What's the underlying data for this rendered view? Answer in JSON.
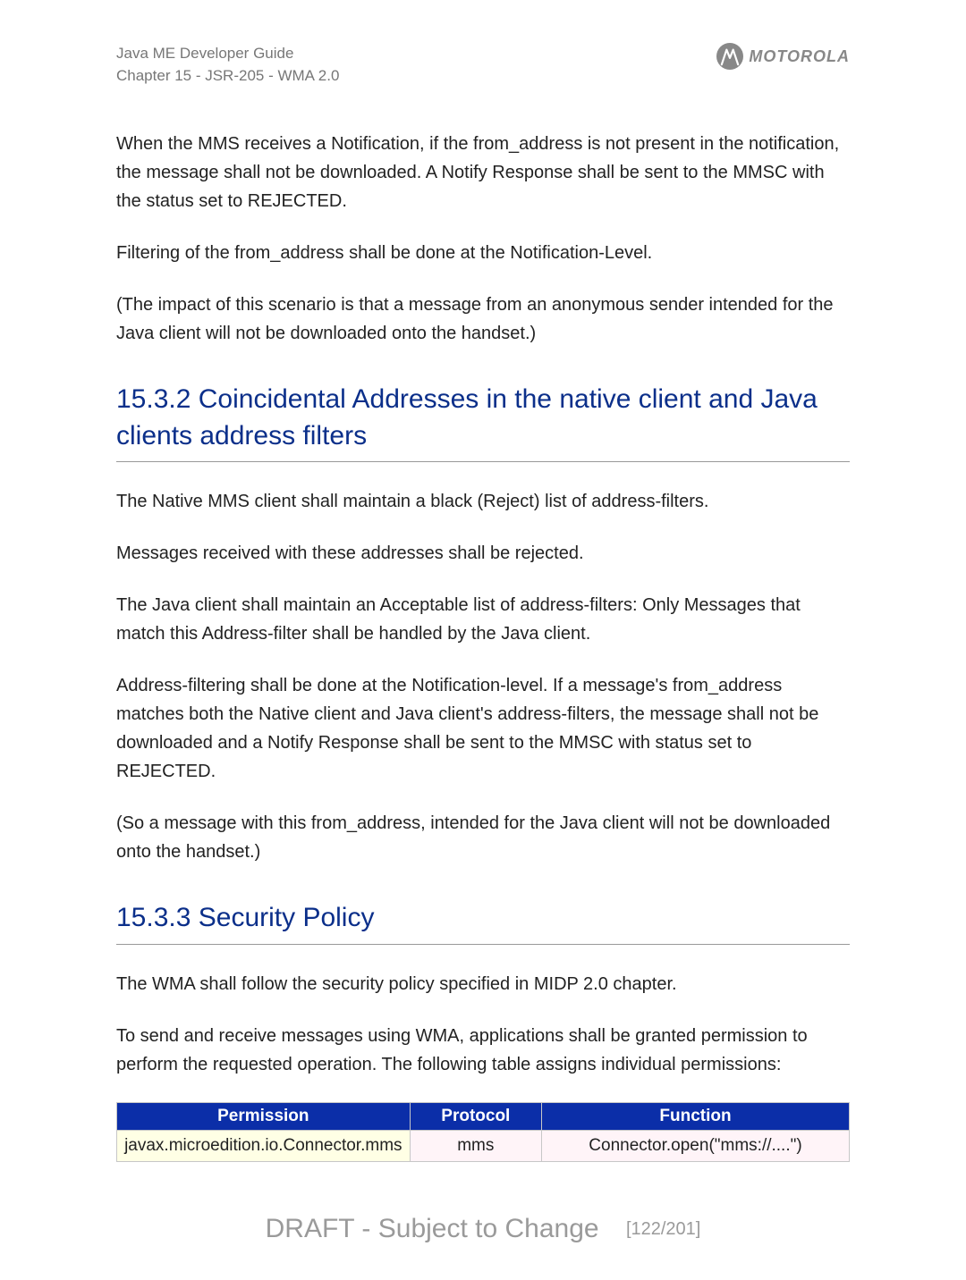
{
  "header": {
    "guide_title": "Java ME Developer Guide",
    "chapter_line": "Chapter 15 - JSR-205 - WMA 2.0",
    "logo_word": "MOTOROLA"
  },
  "paragraphs": {
    "p1": "When the MMS receives a Notification, if the from_address is not present in the notification, the message shall not be downloaded. A Notify Response shall be sent to the MMSC with the status set to REJECTED.",
    "p2": "Filtering of the from_address shall be done at the Notification-Level.",
    "p3": "(The impact of this scenario is that a message from an anonymous sender intended for the Java client will not be downloaded onto the handset.)",
    "p4": "The Native MMS client shall maintain a black (Reject) list of address-filters.",
    "p5": "Messages received with these addresses shall be rejected.",
    "p6": "The Java client shall maintain an Acceptable list of address-filters: Only Messages that match this Address-filter shall be handled by the Java client.",
    "p7": "Address-filtering shall be done at the Notification-level. If a message's from_address matches both the Native client and Java client's address-filters, the message shall not be downloaded and a Notify Response shall be sent to the MMSC with status set to REJECTED.",
    "p8": "(So a message with this from_address, intended for the Java client will not be downloaded onto the handset.)",
    "p9": "The WMA shall follow the security policy specified in MIDP 2.0 chapter.",
    "p10": "To send and receive messages using WMA, applications shall be granted permission to perform the requested operation. The following table assigns individual permissions:"
  },
  "headings": {
    "h1": "15.3.2 Coincidental Addresses in the native client and Java clients address filters",
    "h2": "15.3.3 Security Policy"
  },
  "table": {
    "headers": {
      "c1": "Permission",
      "c2": "Protocol",
      "c3": "Function"
    },
    "row1": {
      "permission": "javax.microedition.io.Connector.mms",
      "protocol": "mms",
      "function": "Connector.open(\"mms://....\")"
    }
  },
  "footer": {
    "draft_text": "DRAFT - Subject to Change",
    "page_indicator": "[122/201]"
  }
}
